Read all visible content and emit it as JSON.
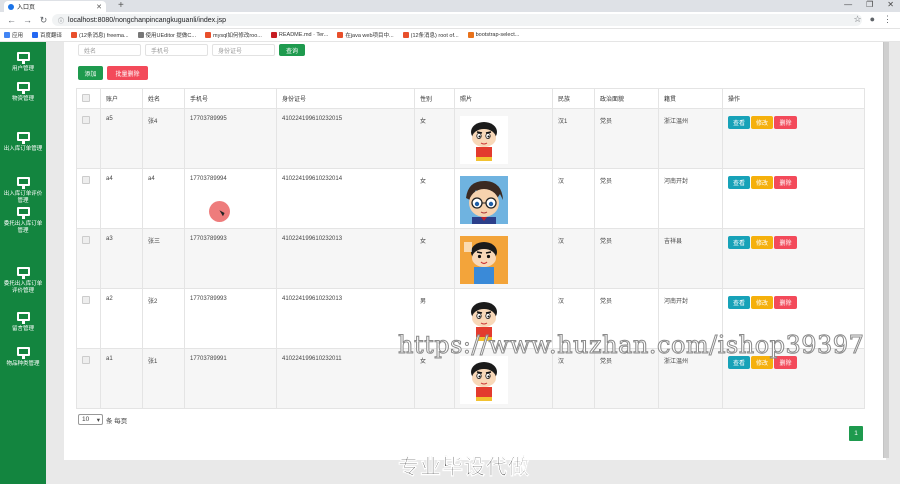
{
  "browser": {
    "tab_title": "入口页",
    "url": "localhost:8080/nongchanpincangkuguanli/index.jsp",
    "bookmarks": [
      {
        "label": "应用",
        "icon": "apps-icon",
        "color": "#4285f4"
      },
      {
        "label": "百度翻译",
        "icon": "translate-icon",
        "color": "#2468f2"
      },
      {
        "label": "(12条消息) freema...",
        "icon": "csdn-icon",
        "color": "#e84f2b"
      },
      {
        "label": "使用UEditor 提做C...",
        "icon": "page-icon",
        "color": "#777777"
      },
      {
        "label": "mysql如何修改roo...",
        "icon": "csdn-icon",
        "color": "#e84f2b"
      },
      {
        "label": "README.md · Ter...",
        "icon": "gitee-icon",
        "color": "#c71d23"
      },
      {
        "label": "在java web项目中...",
        "icon": "csdn-icon",
        "color": "#e84f2b"
      },
      {
        "label": "(12条消息) root of...",
        "icon": "csdn-icon",
        "color": "#e84f2b"
      },
      {
        "label": "bootstrap-select...",
        "icon": "bookmark-icon",
        "color": "#e8711a"
      }
    ]
  },
  "sidebar": {
    "items": [
      {
        "label": "用户管理"
      },
      {
        "label": "物资管理"
      },
      {
        "label": "出入库订单管理"
      },
      {
        "label": "出入库订单评价管理"
      },
      {
        "label": "委托出入库订单管理"
      },
      {
        "label": "委托出入库订单评价管理"
      },
      {
        "label": "留言管理"
      },
      {
        "label": "物品种类管理"
      }
    ]
  },
  "search": {
    "name_placeholder": "姓名",
    "phone_placeholder": "手机号",
    "idcard_placeholder": "身份证号",
    "query_label": "查询"
  },
  "toolbar": {
    "add_label": "添加",
    "batch_delete_label": "批量删除"
  },
  "table": {
    "headers": [
      "账户",
      "姓名",
      "手机号",
      "身份证号",
      "性别",
      "照片",
      "民族",
      "政治面貌",
      "籍贯",
      "操作"
    ],
    "rows": [
      {
        "account": "a5",
        "name": "张4",
        "phone": "17703789995",
        "idcard": "410224199610232015",
        "gender": "女",
        "photo": "crayon-shin-chan",
        "ethnicity": "汉1",
        "political": "党员",
        "hometown": "浙江温州"
      },
      {
        "account": "a4",
        "name": "a4",
        "phone": "17703789994",
        "idcard": "410224199610232014",
        "gender": "女",
        "photo": "detective-conan",
        "ethnicity": "汉",
        "political": "党员",
        "hometown": "河南开封"
      },
      {
        "account": "a3",
        "name": "张三",
        "phone": "17703789993",
        "idcard": "410224199610232013",
        "gender": "女",
        "photo": "crayon-shin-chan-orange",
        "ethnicity": "汉",
        "political": "党员",
        "hometown": "吉祥县"
      },
      {
        "account": "a2",
        "name": "张2",
        "phone": "17703789993",
        "idcard": "410224199610232013",
        "gender": "男",
        "photo": "crayon-shin-chan",
        "ethnicity": "汉",
        "political": "党员",
        "hometown": "河南开封"
      },
      {
        "account": "a1",
        "name": "张1",
        "phone": "17703789991",
        "idcard": "410224199610232011",
        "gender": "女",
        "photo": "crayon-shin-chan",
        "ethnicity": "汉",
        "political": "党员",
        "hometown": "浙江温州"
      }
    ],
    "action_labels": {
      "view": "查看",
      "edit": "修改",
      "delete": "删除"
    }
  },
  "pager": {
    "page_size": "10",
    "per_page_label": "条 每页",
    "current_page": "1"
  },
  "overlay": {
    "watermark": "https://www.huzhan.com/ishop39397",
    "banner": "专业毕设代做"
  },
  "colors": {
    "sidebar_bg": "#13853f",
    "primary_green": "#1e9a4e",
    "danger_red": "#f34a5a",
    "info_blue": "#17a2b8",
    "warning_yellow": "#f5b00c"
  }
}
